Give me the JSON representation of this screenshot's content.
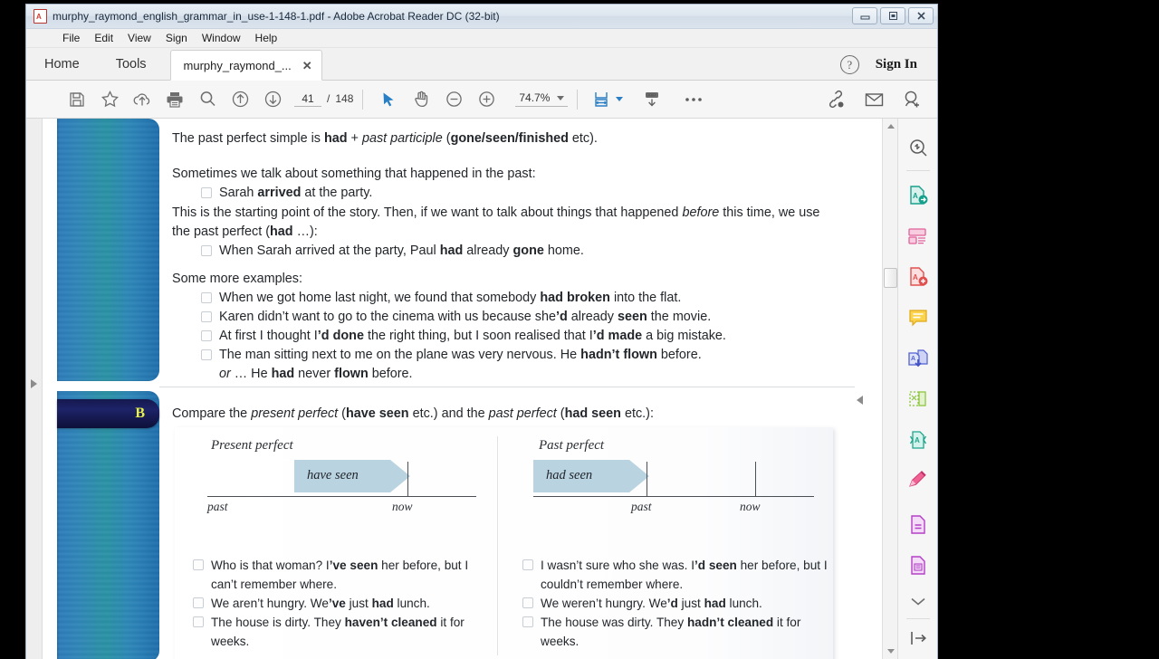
{
  "window": {
    "title": "murphy_raymond_english_grammar_in_use-1-148-1.pdf - Adobe Acrobat Reader DC (32-bit)",
    "app_icon": "pdf-icon",
    "minimize_label": "–",
    "maximize_label": "□",
    "close_label": "✕"
  },
  "menubar": {
    "items": [
      {
        "label": "File"
      },
      {
        "label": "Edit"
      },
      {
        "label": "View"
      },
      {
        "label": "Sign"
      },
      {
        "label": "Window"
      },
      {
        "label": "Help"
      }
    ]
  },
  "tabbar": {
    "home_label": "Home",
    "tools_label": "Tools",
    "doc_tab_label": "murphy_raymond_...",
    "doc_tab_close": "✕",
    "help_label": "?",
    "signin_label": "Sign In"
  },
  "toolbar": {
    "save_label": "save-icon",
    "star_label": "add-to-favourites-icon",
    "upload_label": "upload-to-cloud-icon",
    "print_label": "print-icon",
    "find_label": "find-icon",
    "prev_page_label": "previous-page-icon",
    "next_page_label": "next-page-icon",
    "page_current": "41",
    "page_separator": "/",
    "page_total": "148",
    "select_tool_label": "select-cursor-icon",
    "pan_tool_label": "hand-tool-icon",
    "zoom_out_label": "zoom-out-icon",
    "zoom_in_label": "zoom-in-icon",
    "zoom_value": "74.7%",
    "fit_page_label": "page-fit-icon",
    "scroll_mode_label": "scroll-mode-icon",
    "more_tools_label": "•••",
    "share_link_label": "share-link-icon",
    "email_label": "email-icon",
    "add_person_label": "add-person-icon"
  },
  "right_rail": {
    "tools": [
      {
        "name": "search-reader-icon",
        "title": "Search"
      },
      {
        "name": "export-pdf-icon",
        "title": "Export PDF"
      },
      {
        "name": "create-pdf-icon",
        "title": "Create PDF"
      },
      {
        "name": "edit-pdf-icon",
        "title": "Edit PDF"
      },
      {
        "name": "comment-icon",
        "title": "Comment"
      },
      {
        "name": "combine-files-icon",
        "title": "Combine Files"
      },
      {
        "name": "organize-pages-icon",
        "title": "Organize Pages"
      },
      {
        "name": "compress-pdf-icon",
        "title": "Compress PDF"
      },
      {
        "name": "fill-and-sign-icon",
        "title": "Fill & Sign"
      },
      {
        "name": "request-signatures-icon",
        "title": "Request Signatures"
      },
      {
        "name": "scan-and-ocr-icon",
        "title": "Scan & OCR"
      }
    ],
    "more_label": "chevron-down-icon",
    "collapse_label": "collapse-panel-icon"
  },
  "document": {
    "section_a": {
      "intro_1": {
        "p1": "The past perfect simple is ",
        "b1": "had",
        "p2": " + ",
        "i1": "past participle",
        "p3": " (",
        "b2": "gone/seen/finished",
        "p4": " etc)."
      },
      "intro_2": "Sometimes we talk about something that happened in the past:",
      "bullet_1": {
        "p1": "Sarah ",
        "b1": "arrived",
        "p2": " at the party."
      },
      "intro_3": {
        "p1": "This is the starting point of the story.  Then, if we want to talk about things that happened ",
        "i1": "before",
        "p2": " this time, we use the past perfect (",
        "b1": "had",
        "p3": " …):"
      },
      "bullet_2": {
        "p1": "When Sarah arrived at the party, Paul ",
        "b1": "had",
        "p2": " already ",
        "b2": "gone",
        "p3": " home."
      },
      "more_label": "Some more examples:",
      "examples": [
        {
          "p1": "When we got home last night, we found that somebody ",
          "b1": "had broken",
          "p2": " into the flat."
        },
        {
          "p1": "Karen didn’t want to go to the cinema with us because she",
          "b1": "’d",
          "p2": " already ",
          "b2": "seen",
          "p3": " the movie."
        },
        {
          "p1": "At first I thought I",
          "b1": "’d done",
          "p2": " the right thing, but I soon realised that I",
          "b2": "’d made",
          "p3": " a big mistake."
        },
        {
          "p1": "The man sitting next to me on the plane was very nervous.  He ",
          "b1": "hadn’t flown",
          "p2": " before."
        }
      ],
      "or_line": {
        "i1": "or",
        "p1": "  … He ",
        "b1": "had",
        "p2": " never ",
        "b2": "flown",
        "p3": " before."
      }
    },
    "section_b": {
      "badge": "B",
      "heading": {
        "p1": "Compare the ",
        "i1": "present perfect",
        "p2": " (",
        "b1": "have seen",
        "p3": " etc.) and the ",
        "i2": "past perfect",
        "p4": " (",
        "b2": "had seen",
        "p5": " etc.):"
      },
      "left": {
        "title": "Present perfect",
        "arrow_label": "have seen",
        "axis_labels": {
          "past": "past",
          "now": "now"
        },
        "examples": [
          {
            "p1": "Who is that woman?  I",
            "b1": "’ve seen",
            "p2": " her before, but I can’t remember where."
          },
          {
            "p1": "We aren’t hungry.  We",
            "b1": "’ve",
            "p2": " just ",
            "b2": "had",
            "p3": " lunch."
          },
          {
            "p1": "The house is dirty.  They ",
            "b1": "haven’t cleaned",
            "p2": " it for weeks."
          }
        ]
      },
      "right": {
        "title": "Past perfect",
        "arrow_label": "had seen",
        "axis_labels": {
          "past": "past",
          "now": "now"
        },
        "examples": [
          {
            "p1": "I wasn’t sure who she was.  I",
            "b1": "’d seen",
            "p2": " her before, but I couldn’t remember where."
          },
          {
            "p1": "We weren’t hungry.  We",
            "b1": "’d",
            "p2": " just ",
            "b2": "had",
            "p3": " lunch."
          },
          {
            "p1": "The house was dirty.  They ",
            "b1": "hadn’t cleaned",
            "p2": " it for weeks."
          }
        ]
      }
    }
  },
  "colors": {
    "accent_blue": "#2f7fc0",
    "strip_teal": "#2a93a5",
    "badge_navy": "#15184e",
    "badge_yellow": "#e6f24a",
    "arrow_fill": "#b9d3e0"
  }
}
